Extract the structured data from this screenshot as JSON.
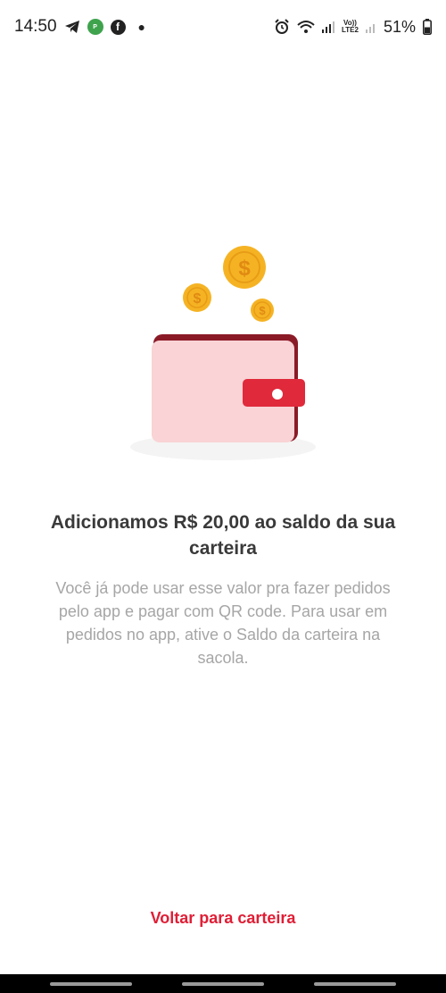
{
  "status_bar": {
    "time": "14:50",
    "lte_top": "Vo))",
    "lte_bottom": "LTE2",
    "battery": "51%",
    "icons": [
      "telegram-icon",
      "app-notification-icon",
      "facebook-icon",
      "alarm-icon",
      "wifi-icon",
      "signal-icon",
      "battery-icon"
    ]
  },
  "content": {
    "title": "Adicionamos R$ 20,00 ao saldo da sua carteira",
    "description": "Você já pode usar esse valor pra fazer pedidos pelo app e pagar com QR code. Para usar em pedidos no app, ative o Saldo da carteira na sacola."
  },
  "actions": {
    "back_label": "Voltar para carteira"
  },
  "colors": {
    "accent": "#e01e35",
    "wallet_body": "#f9d3d5",
    "wallet_edge": "#8b1a27",
    "coin": "#f5b324"
  }
}
